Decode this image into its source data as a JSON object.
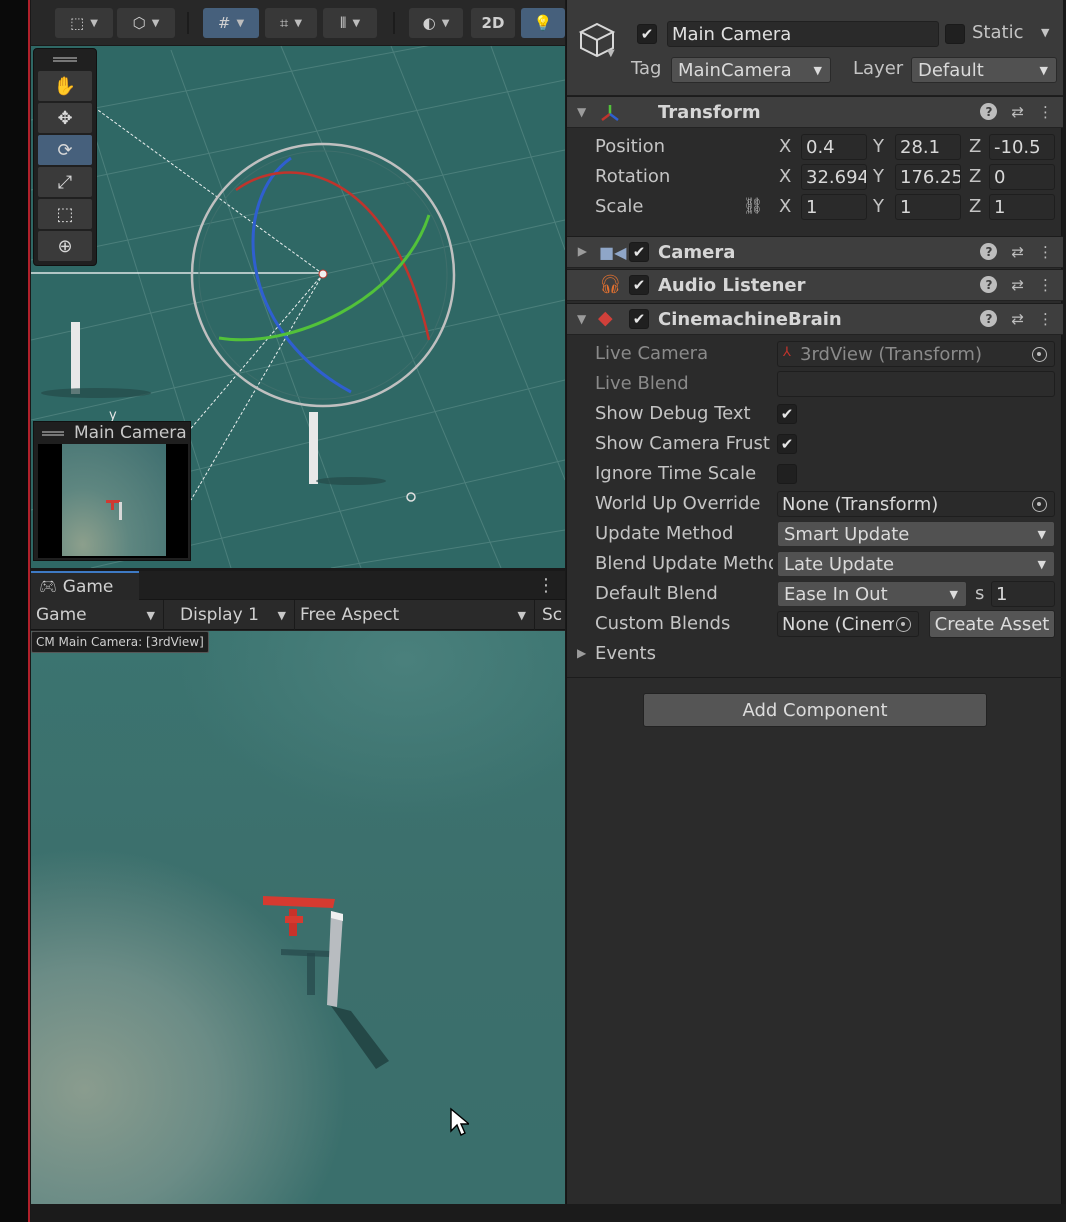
{
  "scene": {
    "toolbar": {
      "twod_label": "2D"
    },
    "camera_preview_title": "Main Camera",
    "axis_label": "y"
  },
  "game": {
    "tab_label": "Game",
    "display_select": "Game",
    "display_number": "Display 1",
    "aspect": "Free Aspect",
    "scale_label": "Sc",
    "cm_label": "CM Main Camera: [3rdView]"
  },
  "inspector": {
    "object_name": "Main Camera",
    "static_label": "Static",
    "tag_label": "Tag",
    "tag_value": "MainCamera",
    "layer_label": "Layer",
    "layer_value": "Default",
    "transform": {
      "title": "Transform",
      "position_label": "Position",
      "rotation_label": "Rotation",
      "scale_label": "Scale",
      "position": {
        "x": "0.4",
        "y": "28.1",
        "z": "-10.5"
      },
      "rotation": {
        "x": "32.694",
        "y": "176.25",
        "z": "0"
      },
      "scale": {
        "x": "1",
        "y": "1",
        "z": "1"
      },
      "axis_x": "X",
      "axis_y": "Y",
      "axis_z": "Z"
    },
    "camera": {
      "title": "Camera"
    },
    "audio_listener": {
      "title": "Audio Listener"
    },
    "brain": {
      "title": "CinemachineBrain",
      "live_camera_label": "Live Camera",
      "live_camera_value": "3rdView (Transform)",
      "live_blend_label": "Live Blend",
      "show_debug_text_label": "Show Debug Text",
      "show_debug_text": true,
      "show_frustum_label": "Show Camera Frustum",
      "show_frustum": true,
      "ignore_time_scale_label": "Ignore Time Scale",
      "ignore_time_scale": false,
      "world_up_label": "World Up Override",
      "world_up_value": "None (Transform)",
      "update_method_label": "Update Method",
      "update_method_value": "Smart Update",
      "blend_update_label": "Blend Update Method",
      "blend_update_value": "Late Update",
      "default_blend_label": "Default Blend",
      "default_blend_value": "Ease In Out",
      "default_blend_s": "s",
      "default_blend_time": "1",
      "custom_blends_label": "Custom Blends",
      "custom_blends_value": "None (Cinemachine",
      "create_asset_label": "Create Asset",
      "events_label": "Events"
    },
    "add_component_label": "Add Component"
  },
  "colors": {
    "accent_active": "#46607c",
    "scene_bg": "#2f6865",
    "inspector_bg": "#2b2b2b",
    "gizmo_red": "#c0342c",
    "gizmo_green": "#52c23a",
    "gizmo_blue": "#2f5fd0"
  }
}
